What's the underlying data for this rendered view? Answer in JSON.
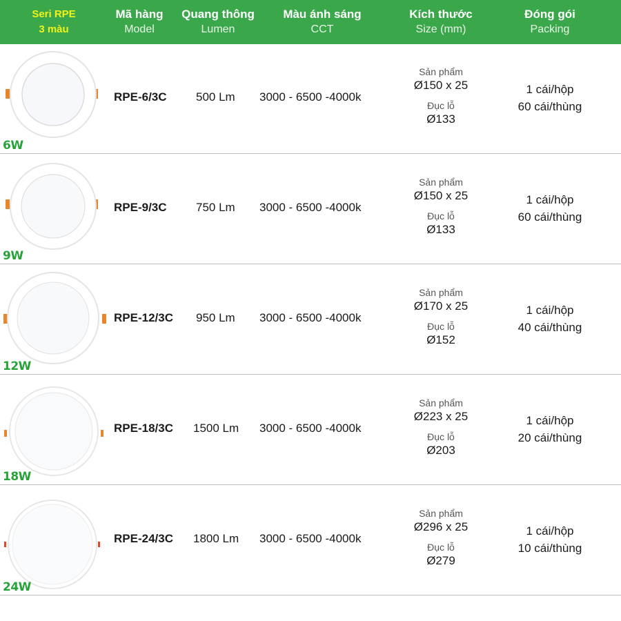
{
  "header": {
    "series_line1": "Seri RPE",
    "series_line2": "3 màu",
    "model_vi": "Mã hàng",
    "model_en": "Model",
    "lumen_vi": "Quang thông",
    "lumen_en": "Lumen",
    "cct_vi": "Màu ánh sáng",
    "cct_en": "CCT",
    "size_vi": "Kích thước",
    "size_en": "Size (mm)",
    "pack_vi": "Đóng gói",
    "pack_en": "Packing"
  },
  "colors": {
    "header_bg": "#3aa84a",
    "series_text": "#f2f21a",
    "wattage": "#27a33a",
    "clip": "#e8862c"
  },
  "rows": [
    {
      "wattage": "6W",
      "model": "RPE-6/3C",
      "lumen": "500 Lm",
      "cct": "3000 - 6500 -4000k",
      "product_label": "Sản phẩm",
      "product_size": "Ø150 x 25",
      "cutout_label": "Đục lỗ",
      "cutout_size": "Ø133",
      "pack_box": "1 cái/hộp",
      "pack_carton": "60 cái/thùng"
    },
    {
      "wattage": "9W",
      "model": "RPE-9/3C",
      "lumen": "750 Lm",
      "cct": "3000 - 6500 -4000k",
      "product_label": "Sản phẩm",
      "product_size": "Ø150 x 25",
      "cutout_label": "Đục lỗ",
      "cutout_size": "Ø133",
      "pack_box": "1 cái/hộp",
      "pack_carton": "60 cái/thùng"
    },
    {
      "wattage": "12W",
      "model": "RPE-12/3C",
      "lumen": "950 Lm",
      "cct": "3000 - 6500 -4000k",
      "product_label": "Sản phẩm",
      "product_size": "Ø170 x 25",
      "cutout_label": "Đục lỗ",
      "cutout_size": "Ø152",
      "pack_box": "1 cái/hộp",
      "pack_carton": "40 cái/thùng"
    },
    {
      "wattage": "18W",
      "model": "RPE-18/3C",
      "lumen": "1500 Lm",
      "cct": "3000 - 6500 -4000k",
      "product_label": "Sản phẩm",
      "product_size": "Ø223 x 25",
      "cutout_label": "Đục lỗ",
      "cutout_size": "Ø203",
      "pack_box": "1 cái/hộp",
      "pack_carton": "20 cái/thùng"
    },
    {
      "wattage": "24W",
      "model": "RPE-24/3C",
      "lumen": "1800 Lm",
      "cct": "3000 - 6500 -4000k",
      "product_label": "Sản phẩm",
      "product_size": "Ø296 x 25",
      "cutout_label": "Đục lỗ",
      "cutout_size": "Ø279",
      "pack_box": "1 cái/hộp",
      "pack_carton": "10 cái/thùng"
    }
  ]
}
